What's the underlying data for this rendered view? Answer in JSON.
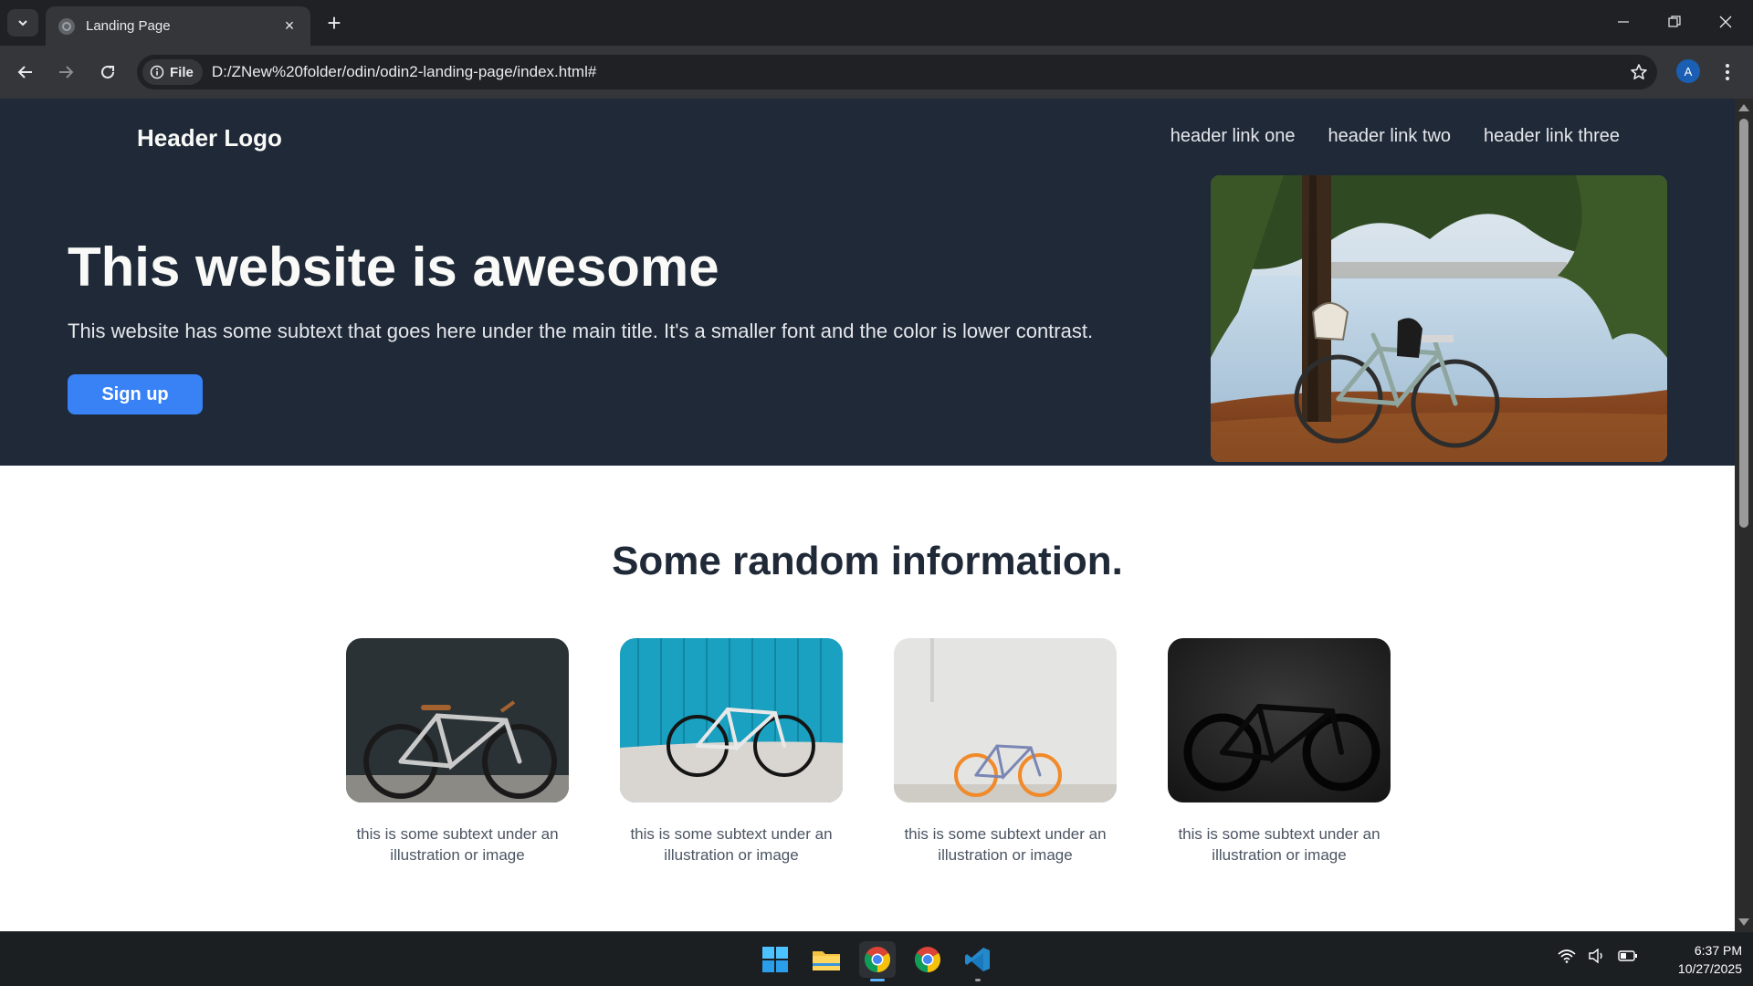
{
  "browser": {
    "tab_title": "Landing Page",
    "url": "D:/ZNew%20folder/odin/odin2-landing-page/index.html#",
    "chip_label": "File",
    "profile_initial": "A"
  },
  "header": {
    "logo": "Header Logo",
    "links": [
      "header link one",
      "header link two",
      "header link three"
    ]
  },
  "hero": {
    "title": "This website is awesome",
    "subtitle": "This website has some subtext that goes here under the main title. It's a smaller font and the color is lower contrast.",
    "signup_label": "Sign up"
  },
  "info": {
    "title": "Some random information.",
    "cards": [
      {
        "text": "this is some subtext under an illustration or image"
      },
      {
        "text": "this is some subtext under an illustration or image"
      },
      {
        "text": "this is some subtext under an illustration or image"
      },
      {
        "text": "this is some subtext under an illustration or image"
      }
    ]
  },
  "taskbar": {
    "time": "6:37 PM",
    "date": "10/27/2025",
    "apps": [
      "start-icon",
      "file-explorer-icon",
      "chrome-icon",
      "chrome-icon",
      "vscode-icon"
    ]
  },
  "colors": {
    "hero_bg": "#1f2937",
    "button": "#3882f6",
    "title_dark": "#1f2937",
    "subtext": "#4b5563"
  }
}
